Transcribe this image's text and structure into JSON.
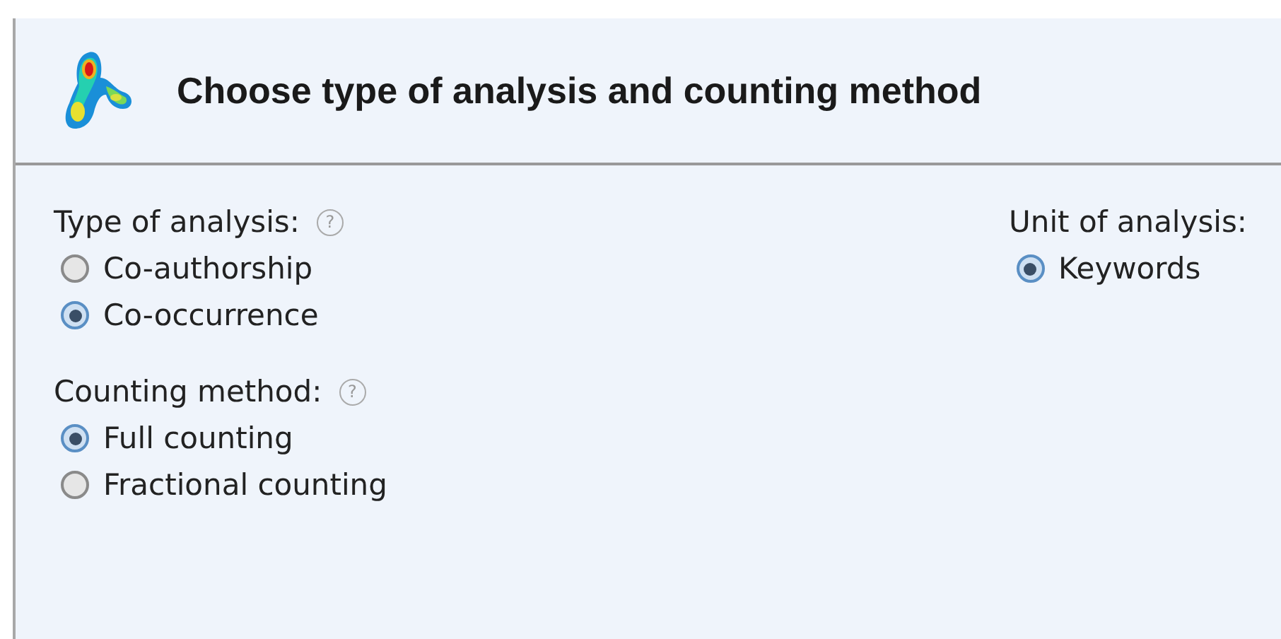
{
  "header": {
    "title": "Choose type of analysis and counting method"
  },
  "groups": [
    {
      "label": "Type of analysis:",
      "help": "?",
      "options": [
        {
          "label": "Co-authorship",
          "selected": false
        },
        {
          "label": "Co-occurrence",
          "selected": true
        }
      ]
    },
    {
      "label": "Counting method:",
      "help": "?",
      "options": [
        {
          "label": "Full counting",
          "selected": true
        },
        {
          "label": "Fractional counting",
          "selected": false
        }
      ]
    }
  ],
  "unit": {
    "label": "Unit of analysis:",
    "options": [
      {
        "label": "Keywords",
        "selected": true
      }
    ]
  }
}
